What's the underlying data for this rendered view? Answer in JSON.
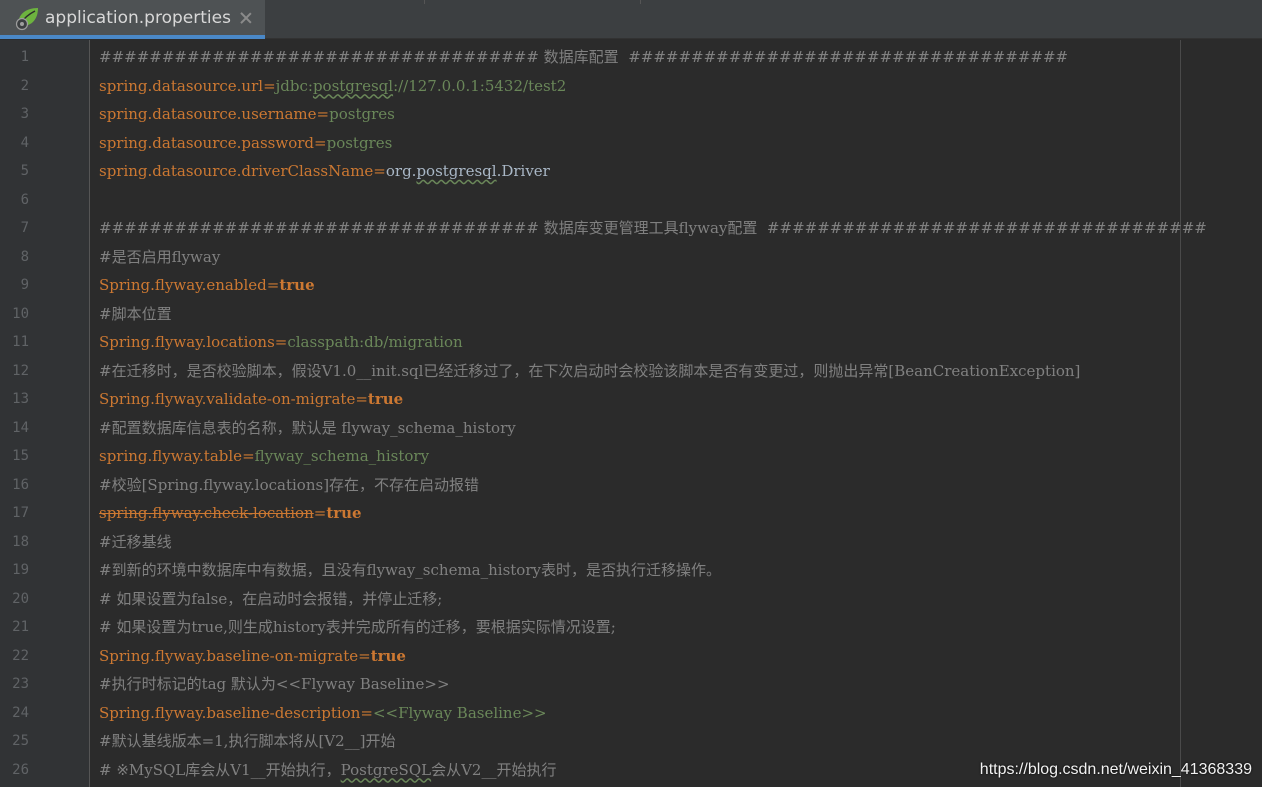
{
  "tab": {
    "filename": "application.properties",
    "icon": "spring-leaf-icon",
    "accent_color": "#4a88c7"
  },
  "editor": {
    "lines": [
      {
        "n": "1",
        "segs": [
          {
            "t": "################################### 数据库配置  ###################################",
            "c": "cmt"
          }
        ]
      },
      {
        "n": "2",
        "segs": [
          {
            "t": "spring.datasource.url",
            "c": "key"
          },
          {
            "t": "=",
            "c": "eq"
          },
          {
            "t": "jdbc:",
            "c": "val"
          },
          {
            "t": "postgresql",
            "c": "val typo"
          },
          {
            "t": "://127.0.0.1:5432/test2",
            "c": "val"
          }
        ]
      },
      {
        "n": "3",
        "segs": [
          {
            "t": "spring.datasource.username",
            "c": "key"
          },
          {
            "t": "=",
            "c": "eq"
          },
          {
            "t": "postgres",
            "c": "val"
          }
        ]
      },
      {
        "n": "4",
        "segs": [
          {
            "t": "spring.datasource.password",
            "c": "key"
          },
          {
            "t": "=",
            "c": "eq"
          },
          {
            "t": "postgres",
            "c": "val"
          }
        ]
      },
      {
        "n": "5",
        "segs": [
          {
            "t": "spring.datasource.driverClassName",
            "c": "key"
          },
          {
            "t": "=",
            "c": "eq"
          },
          {
            "t": "org.",
            "c": "valp"
          },
          {
            "t": "postgresql",
            "c": "valp typo"
          },
          {
            "t": ".Driver",
            "c": "valp"
          }
        ]
      },
      {
        "n": "6",
        "segs": []
      },
      {
        "n": "7",
        "segs": [
          {
            "t": "################################### 数据库变更管理工具flyway配置  ###################################",
            "c": "cmt"
          }
        ]
      },
      {
        "n": "8",
        "segs": [
          {
            "t": "#是否启用flyway",
            "c": "cmt"
          }
        ]
      },
      {
        "n": "9",
        "segs": [
          {
            "t": "Spring.flyway.enabled",
            "c": "key"
          },
          {
            "t": "=",
            "c": "eq"
          },
          {
            "t": "true",
            "c": "bool"
          }
        ]
      },
      {
        "n": "10",
        "segs": [
          {
            "t": "#脚本位置",
            "c": "cmt"
          }
        ]
      },
      {
        "n": "11",
        "segs": [
          {
            "t": "Spring.flyway.locations",
            "c": "key"
          },
          {
            "t": "=",
            "c": "eq"
          },
          {
            "t": "classpath:db/migration",
            "c": "val"
          }
        ]
      },
      {
        "n": "12",
        "segs": [
          {
            "t": "#在迁移时，是否校验脚本，假设V1.0__init.sql已经迁移过了，在下次启动时会校验该脚本是否有变更过，则抛出异常[BeanCreationException]",
            "c": "cmt"
          }
        ]
      },
      {
        "n": "13",
        "segs": [
          {
            "t": "Spring.flyway.validate-on-migrate",
            "c": "key"
          },
          {
            "t": "=",
            "c": "eq"
          },
          {
            "t": "true",
            "c": "bool"
          }
        ]
      },
      {
        "n": "14",
        "segs": [
          {
            "t": "#配置数据库信息表的名称，默认是 flyway_schema_history",
            "c": "cmt"
          }
        ]
      },
      {
        "n": "15",
        "segs": [
          {
            "t": "spring.flyway.table",
            "c": "key"
          },
          {
            "t": "=",
            "c": "eq"
          },
          {
            "t": "flyway_schema_history",
            "c": "val"
          }
        ]
      },
      {
        "n": "16",
        "segs": [
          {
            "t": "#校验[Spring.flyway.locations]存在，不存在启动报错",
            "c": "cmt"
          }
        ]
      },
      {
        "n": "17",
        "segs": [
          {
            "t": "spring.flyway.check-location",
            "c": "key strike"
          },
          {
            "t": "=",
            "c": "eq"
          },
          {
            "t": "true",
            "c": "bool"
          }
        ]
      },
      {
        "n": "18",
        "segs": [
          {
            "t": "#迁移基线",
            "c": "cmt"
          }
        ]
      },
      {
        "n": "19",
        "segs": [
          {
            "t": "#到新的环境中数据库中有数据，且没有flyway_schema_history表时，是否执行迁移操作。",
            "c": "cmt"
          }
        ]
      },
      {
        "n": "20",
        "segs": [
          {
            "t": "# 如果设置为false，在启动时会报错，并停止迁移;",
            "c": "cmt"
          }
        ]
      },
      {
        "n": "21",
        "segs": [
          {
            "t": "# 如果设置为true,则生成history表并完成所有的迁移，要根据实际情况设置;",
            "c": "cmt"
          }
        ]
      },
      {
        "n": "22",
        "segs": [
          {
            "t": "Spring.flyway.baseline-on-migrate",
            "c": "key"
          },
          {
            "t": "=",
            "c": "eq"
          },
          {
            "t": "true",
            "c": "bool"
          }
        ]
      },
      {
        "n": "23",
        "segs": [
          {
            "t": "#执行时标记的tag 默认为<<Flyway Baseline>>",
            "c": "cmt"
          }
        ]
      },
      {
        "n": "24",
        "segs": [
          {
            "t": "Spring.flyway.baseline-description",
            "c": "key"
          },
          {
            "t": "=",
            "c": "eq"
          },
          {
            "t": "<<Flyway Baseline>>",
            "c": "val"
          }
        ]
      },
      {
        "n": "25",
        "segs": [
          {
            "t": "#默认基线版本=1,执行脚本将从[V2__]开始",
            "c": "cmt"
          }
        ]
      },
      {
        "n": "26",
        "segs": [
          {
            "t": "# ※MySQL库会从V1__开始执行，",
            "c": "cmt"
          },
          {
            "t": "PostgreSQL",
            "c": "cmt typo"
          },
          {
            "t": "会从V2__开始执行",
            "c": "cmt"
          }
        ]
      }
    ]
  },
  "watermark": "https://blog.csdn.net/weixin_41368339"
}
